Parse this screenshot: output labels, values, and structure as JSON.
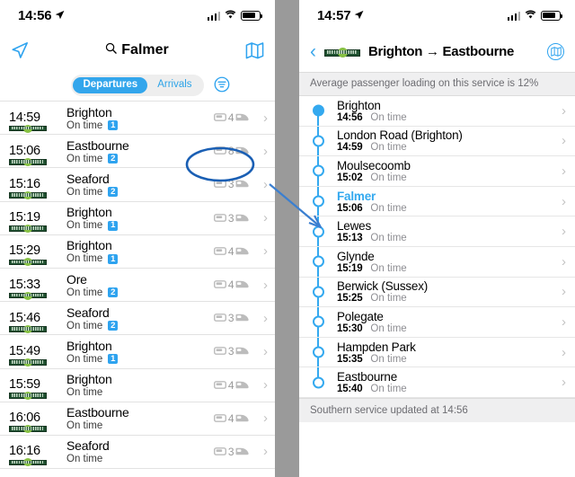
{
  "accent_color": "#34a9ef",
  "annotation_color": "#1a5fb4",
  "left_panel": {
    "status_bar": {
      "time": "14:56",
      "location_icon": "location-arrow-icon",
      "signal_icon": "cellular-bars-icon",
      "wifi_icon": "wifi-icon",
      "battery_icon": "battery-icon"
    },
    "nav": {
      "location_button": "location-arrow-icon",
      "search_icon": "search-icon",
      "title": "Falmer",
      "map_button": "map-icon"
    },
    "segmented": {
      "options": [
        "Departures",
        "Arrivals"
      ],
      "selected": "Departures",
      "filter_button": "filter-icon"
    },
    "departures": [
      {
        "time": "14:59",
        "operator": "southern-logo",
        "destination": "Brighton",
        "status": "On time",
        "platform": "1",
        "coaches": "4"
      },
      {
        "time": "15:06",
        "operator": "southern-logo",
        "destination": "Eastbourne",
        "status": "On time",
        "platform": "2",
        "coaches": "8"
      },
      {
        "time": "15:16",
        "operator": "southern-logo",
        "destination": "Seaford",
        "status": "On time",
        "platform": "2",
        "coaches": "3"
      },
      {
        "time": "15:19",
        "operator": "southern-logo",
        "destination": "Brighton",
        "status": "On time",
        "platform": "1",
        "coaches": "3"
      },
      {
        "time": "15:29",
        "operator": "southern-logo",
        "destination": "Brighton",
        "status": "On time",
        "platform": "1",
        "coaches": "4"
      },
      {
        "time": "15:33",
        "operator": "southern-logo",
        "destination": "Ore",
        "status": "On time",
        "platform": "2",
        "coaches": "4"
      },
      {
        "time": "15:46",
        "operator": "southern-logo",
        "destination": "Seaford",
        "status": "On time",
        "platform": "2",
        "coaches": "3"
      },
      {
        "time": "15:49",
        "operator": "southern-logo",
        "destination": "Brighton",
        "status": "On time",
        "platform": "1",
        "coaches": "3"
      },
      {
        "time": "15:59",
        "operator": "southern-logo",
        "destination": "Brighton",
        "status": "On time",
        "platform": "",
        "coaches": "4"
      },
      {
        "time": "16:06",
        "operator": "southern-logo",
        "destination": "Eastbourne",
        "status": "On time",
        "platform": "",
        "coaches": "4"
      },
      {
        "time": "16:16",
        "operator": "southern-logo",
        "destination": "Seaford",
        "status": "On time",
        "platform": "",
        "coaches": "3"
      }
    ]
  },
  "right_panel": {
    "status_bar": {
      "time": "14:57",
      "location_icon": "location-arrow-icon",
      "signal_icon": "cellular-bars-icon",
      "wifi_icon": "wifi-icon",
      "battery_icon": "battery-icon"
    },
    "nav": {
      "back_button": "chevron-left-icon",
      "operator_logo": "southern-logo",
      "title": "Brighton → Eastbourne",
      "map_button": "map-icon"
    },
    "loading_banner": "Average passenger loading on this service is 12%",
    "stops": [
      {
        "name": "Brighton",
        "time": "14:56",
        "status": "On time",
        "current": false,
        "origin": true
      },
      {
        "name": "London Road (Brighton)",
        "time": "14:59",
        "status": "On time",
        "current": false,
        "origin": false
      },
      {
        "name": "Moulsecoomb",
        "time": "15:02",
        "status": "On time",
        "current": false,
        "origin": false
      },
      {
        "name": "Falmer",
        "time": "15:06",
        "status": "On time",
        "current": true,
        "origin": false
      },
      {
        "name": "Lewes",
        "time": "15:13",
        "status": "On time",
        "current": false,
        "origin": false
      },
      {
        "name": "Glynde",
        "time": "15:19",
        "status": "On time",
        "current": false,
        "origin": false
      },
      {
        "name": "Berwick (Sussex)",
        "time": "15:25",
        "status": "On time",
        "current": false,
        "origin": false
      },
      {
        "name": "Polegate",
        "time": "15:30",
        "status": "On time",
        "current": false,
        "origin": false
      },
      {
        "name": "Hampden Park",
        "time": "15:35",
        "status": "On time",
        "current": false,
        "origin": false
      },
      {
        "name": "Eastbourne",
        "time": "15:40",
        "status": "On time",
        "current": false,
        "origin": false
      }
    ],
    "footer_banner": "Southern service updated at 14:56"
  },
  "annotation": {
    "highlight_target": "15:06 Eastbourne coach count",
    "shape": "ellipse-with-arrow"
  }
}
